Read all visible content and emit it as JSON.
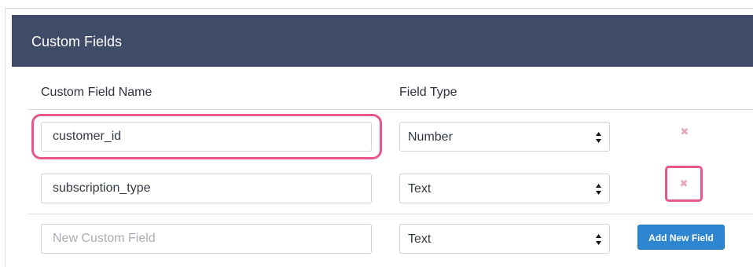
{
  "panel": {
    "title": "Custom Fields"
  },
  "table": {
    "columns": [
      "Custom Field Name",
      "Field Type"
    ],
    "rows": [
      {
        "name_value": "customer_id",
        "field_type": "Number",
        "remove_icon": "close-icon"
      },
      {
        "name_value": "subscription_type",
        "field_type": "Text",
        "remove_icon": "close-icon"
      }
    ],
    "new_field": {
      "placeholder": "New Custom Field",
      "value": "",
      "field_type": "Text",
      "add_button_label": "Add New Field"
    }
  },
  "colors": {
    "header_bg": "#3f4b67",
    "highlight": "#e7578c",
    "remove_icon": "#e7a7bb",
    "add_button": "#2f86d0"
  },
  "icons": {
    "select": "updown-chevron-icon",
    "remove": "close-icon"
  }
}
